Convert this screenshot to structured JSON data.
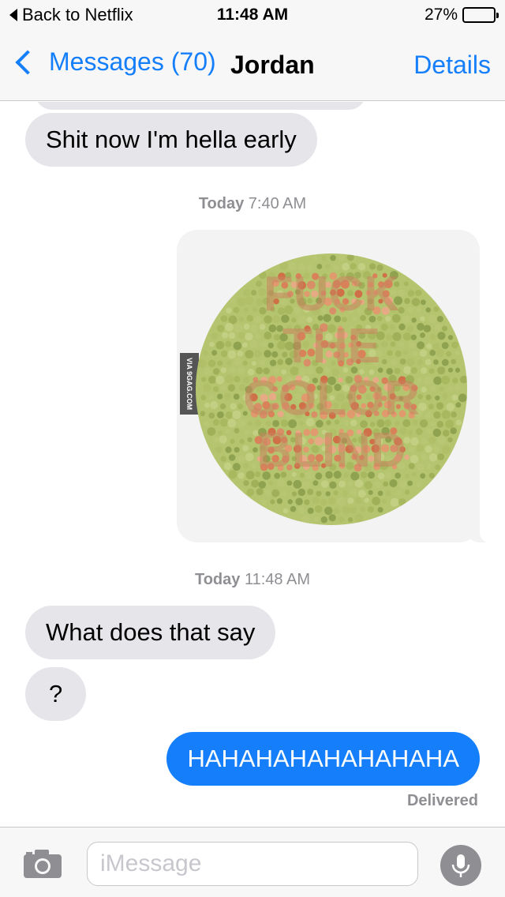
{
  "status_bar": {
    "back_label": "Back to Netflix",
    "time": "11:48 AM",
    "battery_percent": "27%",
    "battery_level": 0.27
  },
  "nav": {
    "back_label": "Messages (70)",
    "title": "Jordan",
    "details_label": "Details"
  },
  "messages": [
    {
      "type": "received",
      "text": "Shit now I'm hella early"
    },
    {
      "type": "timestamp",
      "day": "Today",
      "time": "7:40 AM"
    },
    {
      "type": "sent_image",
      "plate_text": [
        "FUCK",
        "THE",
        "COLOR",
        "BLIND"
      ],
      "watermark": "VIA 9GAG.COM"
    },
    {
      "type": "timestamp",
      "day": "Today",
      "time": "11:48 AM"
    },
    {
      "type": "received",
      "text": "What does that say"
    },
    {
      "type": "received",
      "text": "?"
    },
    {
      "type": "sent",
      "text": "HAHAHAHAHAHAHAHA"
    }
  ],
  "delivery_status": "Delivered",
  "composer": {
    "placeholder": "iMessage"
  },
  "colors": {
    "ios_blue": "#157efb",
    "received_bubble": "#e5e5ea",
    "plate_green": "#b5c46e",
    "plate_orange": "#d9825a"
  },
  "icons": [
    "back-triangle-icon",
    "battery-icon",
    "chevron-left-icon",
    "camera-icon",
    "microphone-icon"
  ]
}
